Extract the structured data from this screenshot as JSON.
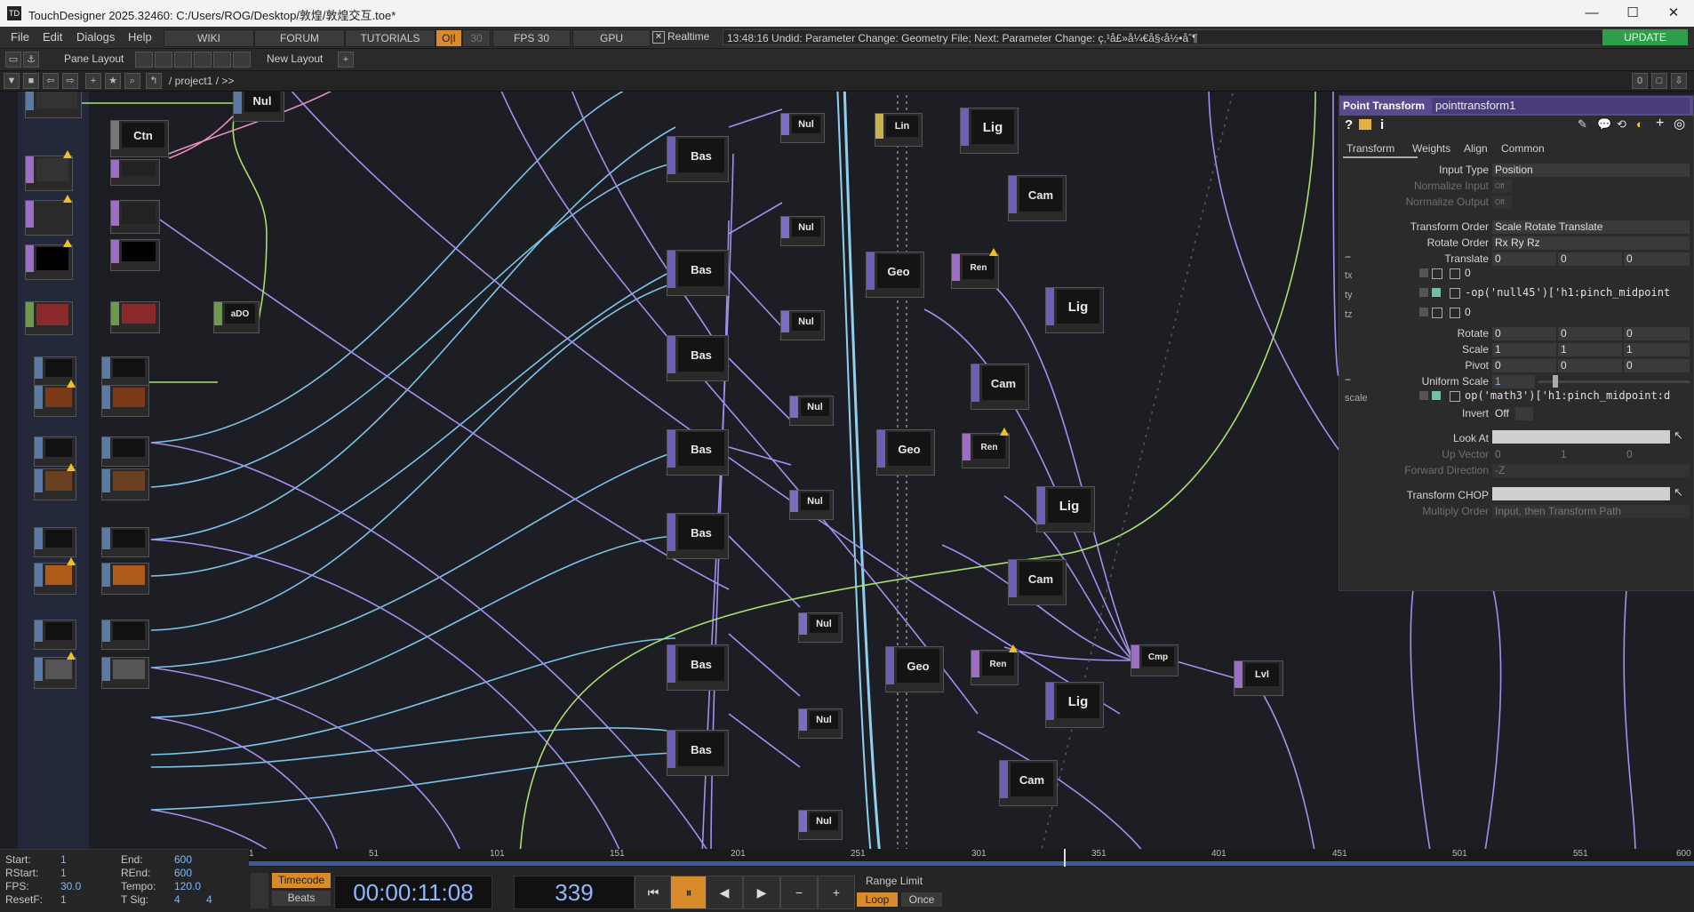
{
  "window": {
    "title": "TouchDesigner 2025.32460: C:/Users/ROG/Desktop/敦煌/敦煌交互.toe*",
    "minimize": "—",
    "maximize": "☐",
    "close": "✕"
  },
  "menu": [
    "File",
    "Edit",
    "Dialogs",
    "Help"
  ],
  "toolbar": {
    "wiki": "WIKI",
    "forum": "FORUM",
    "tutorials": "TUTORIALS",
    "oi": "O|I",
    "fps_cap": "30",
    "fps": "FPS  30",
    "gpu": "GPU",
    "realtime": "Realtime",
    "undo_text": "13:48:16 Undid: Parameter Change: Geometry File; Next: Parameter Change: ç,¹å£»å¼€å§‹å½•åˆ¶",
    "update": "UPDATE"
  },
  "panebar": {
    "pane_layout": "Pane Layout",
    "new_layout": "New Layout",
    "add": "+"
  },
  "pathbar": {
    "path": "/ project1 / >>",
    "right_value": "0"
  },
  "nodes": {
    "nul_top": "Nul",
    "ctn": "Ctn",
    "ado": "aDO",
    "bas": "Bas",
    "nul": "Nul",
    "lin": "Lin",
    "lig": "Lig",
    "cam": "Cam",
    "geo": "Geo",
    "ren": "Ren",
    "cmp": "Cmp",
    "lvl": "Lvl"
  },
  "params": {
    "op_type": "Point Transform",
    "op_name": "pointtransform1",
    "tabs": [
      "Transform",
      "Weights",
      "Align",
      "Common"
    ],
    "input_type_label": "Input Type",
    "input_type": "Position",
    "normalize_input_label": "Normalize Input",
    "normalize_input": "Off",
    "normalize_output_label": "Normalize Output",
    "normalize_output": "Off",
    "transform_order_label": "Transform Order",
    "transform_order": "Scale Rotate Translate",
    "rotate_order_label": "Rotate Order",
    "rotate_order": "Rx Ry Rz",
    "translate_label": "Translate",
    "translate": [
      "0",
      "0",
      "0"
    ],
    "tx_label": "tx",
    "tx": "0",
    "ty_label": "ty",
    "ty": "-op('null45')['h1:pinch_midpoint",
    "tz_label": "tz",
    "tz": "0",
    "rotate_label": "Rotate",
    "rotate": [
      "0",
      "0",
      "0"
    ],
    "scale_label": "Scale",
    "scale": [
      "1",
      "1",
      "1"
    ],
    "pivot_label": "Pivot",
    "pivot": [
      "0",
      "0",
      "0"
    ],
    "uniform_scale_label": "Uniform Scale",
    "uniform_scale": "1",
    "scale_sub_label": "scale",
    "scale_expr": "op('math3')['h1:pinch_midpoint:d",
    "invert_label": "Invert",
    "invert": "Off",
    "look_at_label": "Look At",
    "up_vector_label": "Up Vector",
    "up_vector": [
      "0",
      "1",
      "0"
    ],
    "forward_direction_label": "Forward Direction",
    "forward_direction": "-Z",
    "transform_chop_label": "Transform CHOP",
    "multiply_order_label": "Multiply Order",
    "multiply_order": "Input, then Transform Path"
  },
  "ruler": [
    "1",
    "51",
    "101",
    "151",
    "201",
    "251",
    "301",
    "351",
    "401",
    "451",
    "501",
    "551",
    "600"
  ],
  "timeline": {
    "start_label": "Start:",
    "start": "1",
    "rstart_label": "RStart:",
    "rstart": "1",
    "fps_label": "FPS:",
    "fps": "30.0",
    "resetf_label": "ResetF:",
    "resetf": "1",
    "end_label": "End:",
    "end": "600",
    "rend_label": "REnd:",
    "rend": "600",
    "tempo_label": "Tempo:",
    "tempo": "120.0",
    "tsig_label": "T Sig:",
    "tsig_a": "4",
    "tsig_b": "4",
    "timecode": "Timecode",
    "beats": "Beats",
    "time": "00:00:11:08",
    "frame": "339",
    "range_limit": "Range Limit",
    "loop": "Loop",
    "once": "Once"
  },
  "colors": {
    "sop_flag": "#7b6cc4",
    "wire_blue": "#7cc4e8",
    "wire_purple": "#a68ef0",
    "wire_green": "#a8e070",
    "wire_pink": "#e890c0",
    "update_green": "#2f9e49",
    "param_header": "#5b4a8e"
  }
}
